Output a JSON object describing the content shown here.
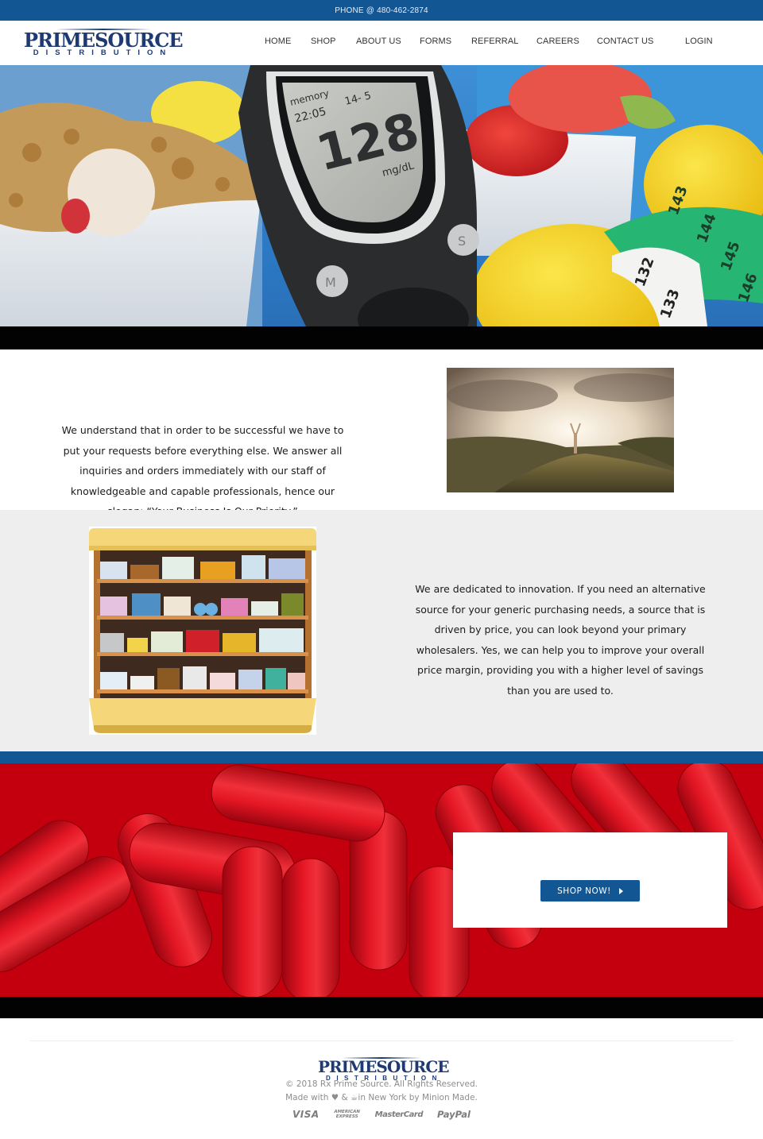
{
  "topbar": {
    "phone_text": "PHONE @ 480-462-2874"
  },
  "header": {
    "logo": {
      "brand": "PRIMESOURCE",
      "sub": "DISTRIBUTION"
    },
    "nav": [
      {
        "label": "HOME"
      },
      {
        "label": "SHOP"
      },
      {
        "label": "ABOUT US"
      },
      {
        "label": "FORMS"
      },
      {
        "label": "REFERRAL"
      },
      {
        "label": "CAREERS"
      },
      {
        "label": "CONTACT US"
      },
      {
        "label": "LOGIN"
      }
    ]
  },
  "hero": {
    "image_desc": "Glucose meter, cereal bowl, strawberries, yellow dumbbells and measuring tape",
    "meter": {
      "memory_label": "memory",
      "time": "22:05",
      "date": "14- 5",
      "reading": "128",
      "unit": "mg/dL",
      "button_s": "S",
      "button_m": "M"
    },
    "tape_numbers_green": [
      "143",
      "144",
      "145",
      "146"
    ],
    "tape_numbers_white": [
      "132",
      "133"
    ]
  },
  "about": {
    "text": "We understand that in order to be successful we have to put your requests before everything else. We answer all inquiries and orders immediately with our staff of knowledgeable and capable professionals, hence our slogan: “Your Business Is Our Priority.”",
    "image_desc": "Person with raised arms on hilltop at sunrise"
  },
  "innovation": {
    "text": "We are dedicated to innovation. If you need an alternative source for your generic purchasing needs, a source that is driven by price, you can look beyond your primary wholesalers. Yes, we can help you to improve your overall price margin, providing you with a higher level of savings than you are used to.",
    "image_desc": "Pharmacy shelf illustration with medicine products"
  },
  "promo": {
    "image_desc": "Red capsule pills",
    "shop_button_label": "SHOP NOW!"
  },
  "footer": {
    "logo": {
      "brand": "PRIMESOURCE",
      "sub": "DISTRIBUTION"
    },
    "copyright": "© 2018 Rx Prime Source. All Rights Reserved.",
    "made_with_prefix": "Made with",
    "made_with_amp": "&",
    "made_with_suffix": "in New York by Minion Made.",
    "payment_methods": [
      "VISA",
      "AMERICAN EXPRESS",
      "MasterCard",
      "PayPal"
    ]
  },
  "colors": {
    "brand_blue": "#135694",
    "logo_navy": "#1d3b72",
    "band_black": "#020203",
    "section_gray": "#eeeeee",
    "footer_text": "#8d8d8d"
  }
}
